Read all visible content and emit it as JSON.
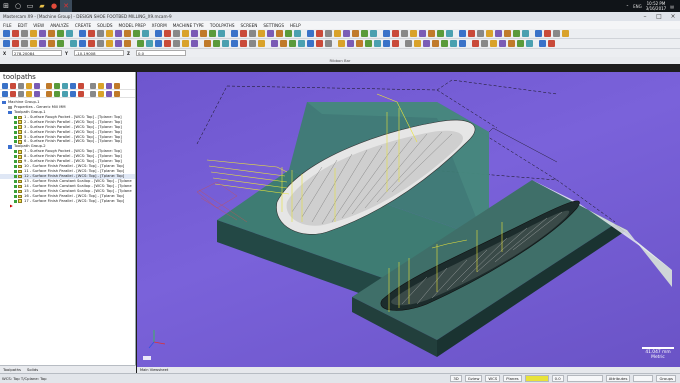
{
  "taskbar": {
    "time": "10:52 PM",
    "date": "3/16/2017",
    "language": "ENG"
  },
  "window": {
    "title": "Mastercam X9 - [Machine Group] - DESIGN SHOE FOOTBED MILLING_X9.mcam-9"
  },
  "menu": [
    "FILE",
    "EDIT",
    "VIEW",
    "ANALYZE",
    "CREATE",
    "SOLIDS",
    "MODEL PREP",
    "XFORM",
    "MACHINE TYPE",
    "TOOLPATHS",
    "SCREEN",
    "SETTINGS",
    "HELP"
  ],
  "coords": {
    "x_label": "X",
    "x_value": "278.20084",
    "y_label": "Y",
    "y_value": "-10.19008",
    "z_label": "Z",
    "z_value": "0.0"
  },
  "ribbon_label": "Ribbon Bar",
  "panel": {
    "title": "toolpaths",
    "tree": [
      "Machine Group-1",
      "Properties - Generic Mill MM",
      "Toolpath Group-1",
      "1 - Surface Rough Pocket - [WCS: Top] - [Tplane: Top]",
      "2 - Surface Finish Parallel - [WCS: Top] - [Tplane: Top]",
      "3 - Surface Finish Parallel - [WCS: Top] - [Tplane: Top]",
      "4 - Surface Finish Parallel - [WCS: Top] - [Tplane: Top]",
      "5 - Surface Finish Parallel - [WCS: Top] - [Tplane: Top]",
      "6 - Surface Finish Parallel - [WCS: Top] - [Tplane: Top]",
      "Toolpath Group-2",
      "7 - Surface Rough Pocket - [WCS: Top] - [Tplane: Top]",
      "8 - Surface Finish Parallel - [WCS: Top] - [Tplane: Top]",
      "9 - Surface Finish Parallel - [WCS: Top] - [Tplane: Top]",
      "10 - Surface Finish Parallel - [WCS: Top] - [Tplane: Top]",
      "11 - Surface Finish Parallel - [WCS: Top] - [Tplane: Top]",
      "12 - Surface Finish Parallel - [WCS: Top] - [Tplane: Top]",
      "13 - Surface Finish Constant Scallop - [WCS: Top] - [Tplane",
      "14 - Surface Finish Constant Scallop - [WCS: Top] - [Tplane",
      "15 - Surface Finish Constant Scallop - [WCS: Top] - [Tplane",
      "16 - Surface Finish Parallel - [WCS: Top] - [Tplane: Top]",
      "17 - Surface Finish Parallel - [WCS: Top] - [Tplane: Top]"
    ],
    "tabs": [
      "Toolpaths",
      "Solids"
    ]
  },
  "viewport": {
    "tab": "Main Viewsheet",
    "scale_value": "41.047 mm",
    "scale_unit": "Metric"
  },
  "status": {
    "wcs": "WCS: Top   T/Cplane: Top",
    "items": [
      "3D",
      "Gview",
      "WCS",
      "Planes",
      "0.0"
    ],
    "right_items": [
      "Attributes",
      "Groups"
    ]
  },
  "colors": {
    "viewport_bg": "#6e56ce",
    "stock_top": "#2f5f58",
    "toolpath_yellow": "#e8e23a"
  }
}
